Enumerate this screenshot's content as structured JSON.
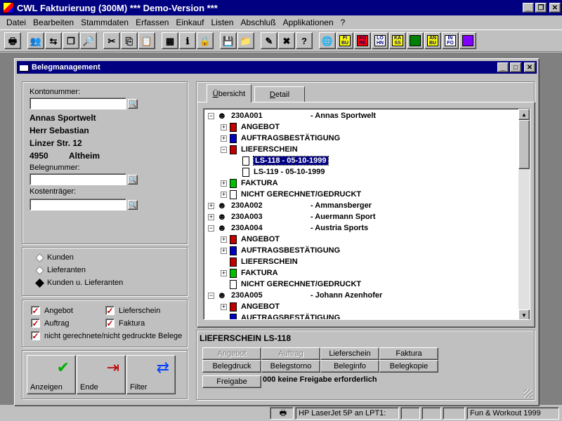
{
  "app": {
    "title": "CWL Fakturierung (300M) *** Demo-Version ***",
    "icon": "cwl-app-icon"
  },
  "menu": [
    "Datei",
    "Bearbeiten",
    "Stammdaten",
    "Erfassen",
    "Einkauf",
    "Listen",
    "Abschluß",
    "Applikationen",
    "?"
  ],
  "toolbar": {
    "groups": [
      [
        {
          "icon": "printer-icon"
        }
      ],
      [
        {
          "icon": "people-red-icon"
        },
        {
          "icon": "people-swap-icon"
        },
        {
          "icon": "document-copy-icon"
        },
        {
          "icon": "document-search-icon"
        }
      ],
      [
        {
          "icon": "scissors-icon"
        },
        {
          "icon": "copy-icon"
        },
        {
          "icon": "paste-icon"
        }
      ],
      [
        {
          "icon": "calculator-icon"
        },
        {
          "icon": "info-book-icon"
        },
        {
          "icon": "lock-icon"
        }
      ],
      [
        {
          "icon": "floppy-edit-icon"
        },
        {
          "icon": "folder-chart-icon"
        }
      ],
      [
        {
          "icon": "note-icon"
        },
        {
          "icon": "cancel-doc-icon"
        },
        {
          "icon": "help-icon"
        }
      ],
      [
        {
          "icon": "globe-icon"
        },
        {
          "label": "FI\nBU"
        },
        {
          "label": "KO\nRE"
        },
        {
          "label": "LO\nHN"
        },
        {
          "label": "KA\nSS"
        },
        {
          "label": ""
        },
        {
          "label": "AN\nBU"
        },
        {
          "label": "IN\nFO"
        },
        {
          "label": ""
        }
      ]
    ]
  },
  "window": {
    "title": "Belegmanagement"
  },
  "search": {
    "kontonummer_label": "Kontonummer:",
    "kontonummer_value": "",
    "customer_name": "Annas Sportwelt",
    "contact": "Herr Sebastian",
    "street": "Linzer Str. 12",
    "zip": "4950",
    "city": "Altheim",
    "belegnummer_label": "Belegnummer:",
    "belegnummer_value": "",
    "kostentraeger_label": "Kostenträger:",
    "kostentraeger_value": ""
  },
  "radios": [
    {
      "label": "Kunden",
      "selected": false
    },
    {
      "label": "Lieferanten",
      "selected": false
    },
    {
      "label": "Kunden u. Lieferanten",
      "selected": true
    }
  ],
  "checks": {
    "angebot": {
      "label": "Angebot",
      "checked": true
    },
    "lieferschein": {
      "label": "Lieferschein",
      "checked": true
    },
    "auftrag": {
      "label": "Auftrag",
      "checked": true
    },
    "faktura": {
      "label": "Faktura",
      "checked": true
    },
    "nicht": {
      "label": "nicht gerechnete/nicht gedruckte Belege",
      "checked": true
    }
  },
  "actions": {
    "anzeigen": "Anzeigen",
    "ende": "Ende",
    "filter": "Filter"
  },
  "tabs": {
    "uebersicht": "Übersicht",
    "detail": "Detail"
  },
  "tree": [
    {
      "level": 0,
      "kind": "customer",
      "expander": "−",
      "code": "230A001",
      "name": "- Annas Sportwelt"
    },
    {
      "level": 1,
      "kind": "doc",
      "color": "red",
      "expander": "+",
      "label": "ANGEBOT"
    },
    {
      "level": 1,
      "kind": "doc",
      "color": "blue",
      "expander": "+",
      "label": "AUFTRAGSBESTÄTIGUNG"
    },
    {
      "level": 1,
      "kind": "doc",
      "color": "red",
      "expander": "−",
      "label": "LIEFERSCHEIN"
    },
    {
      "level": 2,
      "kind": "leaf",
      "color": "white",
      "label": "LS-118 - 05-10-1999",
      "selected": true
    },
    {
      "level": 2,
      "kind": "leaf",
      "color": "white",
      "label": "LS-119 - 05-10-1999"
    },
    {
      "level": 1,
      "kind": "doc",
      "color": "green",
      "expander": "+",
      "label": "FAKTURA"
    },
    {
      "level": 1,
      "kind": "doc",
      "color": "white",
      "expander": "+",
      "label": "NICHT GERECHNET/GEDRUCKT"
    },
    {
      "level": 0,
      "kind": "customer",
      "expander": "+",
      "code": "230A002",
      "name": "- Ammansberger"
    },
    {
      "level": 0,
      "kind": "customer",
      "expander": "+",
      "code": "230A003",
      "name": "- Auermann Sport"
    },
    {
      "level": 0,
      "kind": "customer",
      "expander": "−",
      "code": "230A004",
      "name": "- Austria Sports"
    },
    {
      "level": 1,
      "kind": "doc",
      "color": "red",
      "expander": "+",
      "label": "ANGEBOT"
    },
    {
      "level": 1,
      "kind": "doc",
      "color": "blue",
      "expander": "+",
      "label": "AUFTRAGSBESTÄTIGUNG"
    },
    {
      "level": 1,
      "kind": "doc",
      "color": "red",
      "expander": "",
      "label": "LIEFERSCHEIN"
    },
    {
      "level": 1,
      "kind": "doc",
      "color": "green",
      "expander": "+",
      "label": "FAKTURA"
    },
    {
      "level": 1,
      "kind": "doc",
      "color": "white",
      "expander": "",
      "label": "NICHT GERECHNET/GEDRUCKT"
    },
    {
      "level": 0,
      "kind": "customer",
      "expander": "−",
      "code": "230A005",
      "name": "- Johann Azenhofer"
    },
    {
      "level": 1,
      "kind": "doc",
      "color": "red",
      "expander": "+",
      "label": "ANGEBOT"
    },
    {
      "level": 1,
      "kind": "doc",
      "color": "blue",
      "expander": "",
      "label": "AUFTRAGSBESTÄTIGUNG"
    }
  ],
  "detail": {
    "title": "LIEFERSCHEIN LS-118",
    "buttons": [
      {
        "label": "Angebot",
        "enabled": false
      },
      {
        "label": "Auftrag",
        "enabled": false
      },
      {
        "label": "Lieferschein",
        "enabled": true
      },
      {
        "label": "Faktura",
        "enabled": true
      },
      {
        "label": "Belegdruck",
        "enabled": true
      },
      {
        "label": "Belegstorno",
        "enabled": true
      },
      {
        "label": "Beleginfo",
        "enabled": true
      },
      {
        "label": "Belegkopie",
        "enabled": true
      }
    ],
    "freigabe_label": "Freigabe",
    "freigabe_text": "000 keine Freigabe erforderlich"
  },
  "status": {
    "printer": "HP LaserJet 5P an LPT1:",
    "company": "Fun & Workout 1999"
  }
}
